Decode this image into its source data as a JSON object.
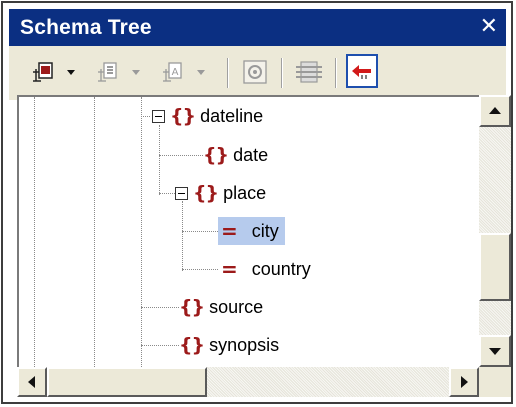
{
  "window": {
    "title": "Schema Tree"
  },
  "toolbar": {
    "buttons": [
      {
        "icon": "insert-element-icon"
      },
      {
        "icon": "dropdown-arrow-icon"
      },
      {
        "icon": "add-child-element-icon"
      },
      {
        "icon": "dropdown-arrow-icon"
      },
      {
        "icon": "add-attribute-icon"
      },
      {
        "icon": "dropdown-arrow-icon"
      },
      {
        "icon": "settings-icon"
      },
      {
        "icon": "collapse-tree-icon"
      },
      {
        "icon": "sync-arrow-icon"
      }
    ]
  },
  "tree": {
    "nodes": [
      {
        "label": "dateline",
        "type": "element",
        "expanded": true
      },
      {
        "label": "date",
        "type": "element"
      },
      {
        "label": "place",
        "type": "element",
        "expanded": true
      },
      {
        "label": "city",
        "type": "attribute",
        "selected": true
      },
      {
        "label": "country",
        "type": "attribute"
      },
      {
        "label": "source",
        "type": "element"
      },
      {
        "label": "synopsis",
        "type": "element"
      }
    ]
  },
  "icons": {
    "element_glyph": "{}",
    "attribute_glyph": "="
  },
  "colors": {
    "titlebar": "#0b2f82",
    "icon_red": "#9c1a1a",
    "selection": "#b6cbed"
  }
}
